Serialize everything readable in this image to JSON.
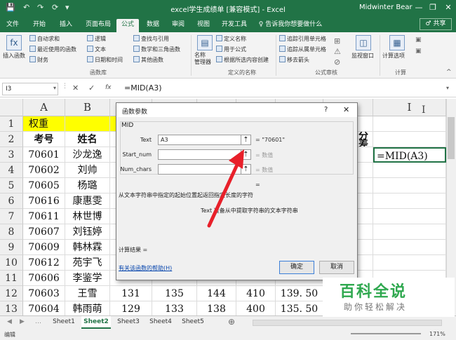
{
  "window": {
    "title": "excel学生成绩单 [兼容模式] - Excel",
    "user": "Midwinter Bear",
    "min": "—",
    "restore": "❐",
    "close": "✕",
    "qa_icons": [
      "💾",
      "↶",
      "↷",
      "⟳",
      "▾"
    ]
  },
  "tabs": [
    {
      "label": "文件"
    },
    {
      "label": "开始"
    },
    {
      "label": "插入"
    },
    {
      "label": "页面布局"
    },
    {
      "label": "公式",
      "active": true
    },
    {
      "label": "数据"
    },
    {
      "label": "审阅"
    },
    {
      "label": "视图"
    },
    {
      "label": "开发工具"
    },
    {
      "label": "♀ 告诉我你想要做什么"
    }
  ],
  "share": "♂ 共享",
  "ribbon": {
    "insert_function": "插入函数",
    "library": {
      "autosum": "自动求和",
      "recent": "最近使用的函数",
      "finance": "财务",
      "logic": "逻辑",
      "text": "文本",
      "datetime": "日期和时间",
      "lookup": "查找与引用",
      "math": "数学和三角函数",
      "other": "其他函数",
      "group": "函数库"
    },
    "names": {
      "manager": "名称\n管理器",
      "define": "定义名称",
      "use": "用于公式",
      "create": "根据所选内容创建",
      "group": "定义的名称"
    },
    "audit": {
      "precedents": "追踪引用单元格",
      "dependents": "追踪从属单元格",
      "remove": "移去箭头",
      "watch": "监视窗口",
      "group": "公式审核"
    },
    "calc": {
      "options": "计算选项",
      "group": "计算"
    }
  },
  "formula_bar": {
    "name_box": "I3",
    "formula": "=MID(A3)",
    "cancel": "✕",
    "enter": "✓",
    "fx": "fx"
  },
  "sheet": {
    "columns": [
      "A",
      "B",
      "C",
      "D",
      "E",
      "F",
      "G",
      "H",
      "I"
    ],
    "rows": [
      {
        "n": "1",
        "cells": [
          "权重",
          "",
          "",
          "",
          "",
          "",
          "",
          "",
          ""
        ]
      },
      {
        "n": "2",
        "cells": [
          "考号",
          "姓名",
          "",
          "",
          "",
          "",
          "",
          "分\n差",
          ""
        ]
      },
      {
        "n": "3",
        "cells": [
          "70601",
          "沙龙逸",
          "",
          "",
          "",
          "",
          "",
          "",
          "=MID(A3)"
        ]
      },
      {
        "n": "4",
        "cells": [
          "70602",
          "刘帅",
          "",
          "",
          "",
          "",
          "",
          "",
          ""
        ]
      },
      {
        "n": "5",
        "cells": [
          "70605",
          "杨璐",
          "",
          "",
          "",
          "",
          "",
          "",
          ""
        ]
      },
      {
        "n": "6",
        "cells": [
          "70616",
          "康惠雯",
          "",
          "",
          "",
          "",
          "",
          "",
          ""
        ]
      },
      {
        "n": "7",
        "cells": [
          "70611",
          "林世博",
          "",
          "",
          "",
          "",
          "",
          "",
          ""
        ]
      },
      {
        "n": "8",
        "cells": [
          "70607",
          "刘钰婷",
          "",
          "",
          "",
          "",
          "",
          "",
          ""
        ]
      },
      {
        "n": "9",
        "cells": [
          "70609",
          "韩林霖",
          "",
          "",
          "",
          "",
          "",
          "",
          ""
        ]
      },
      {
        "n": "10",
        "cells": [
          "70612",
          "苑宇飞",
          "",
          "",
          "",
          "",
          "",
          "",
          ""
        ]
      },
      {
        "n": "11",
        "cells": [
          "70606",
          "李鉴学",
          "",
          "",
          "",
          "",
          "",
          "",
          ""
        ]
      },
      {
        "n": "12",
        "cells": [
          "70603",
          "王雪",
          "131",
          "135",
          "144",
          "410",
          "139. 50",
          "",
          ""
        ]
      },
      {
        "n": "13",
        "cells": [
          "70604",
          "韩雨萌",
          "129",
          "133",
          "138",
          "400",
          "135. 50",
          "",
          ""
        ]
      }
    ]
  },
  "dialog": {
    "title": "函数参数",
    "help_q": "?",
    "close": "✕",
    "func": "MID",
    "args": [
      {
        "label": "Text",
        "value": "A3",
        "result": "= \"70601\""
      },
      {
        "label": "Start_num",
        "value": "",
        "result": "= 数值"
      },
      {
        "label": "Num_chars",
        "value": "",
        "result": "= 数值"
      }
    ],
    "eq": "=",
    "desc": "从文本字符串中指定的起始位置起返回指定长度的字符",
    "arg_desc": "Text  准备从中提取字符串的文本字符串",
    "calc_result": "计算结果 =",
    "help_link": "有关该函数的帮助(H)",
    "ok": "确定",
    "cancel": "取消"
  },
  "sheet_tabs": [
    "Sheet1",
    "Sheet2",
    "Sheet3",
    "Sheet4",
    "Sheet5"
  ],
  "active_sheet": "Sheet2",
  "add_sheet": "⊕",
  "status": {
    "mode": "编辑",
    "zoom": "171%"
  },
  "watermark": {
    "line1": "百科全说",
    "line2": "助你轻松解决"
  },
  "colors": {
    "excel_green": "#217346",
    "weight_yellow": "#ffff00",
    "arrow_red": "#e8202a"
  }
}
